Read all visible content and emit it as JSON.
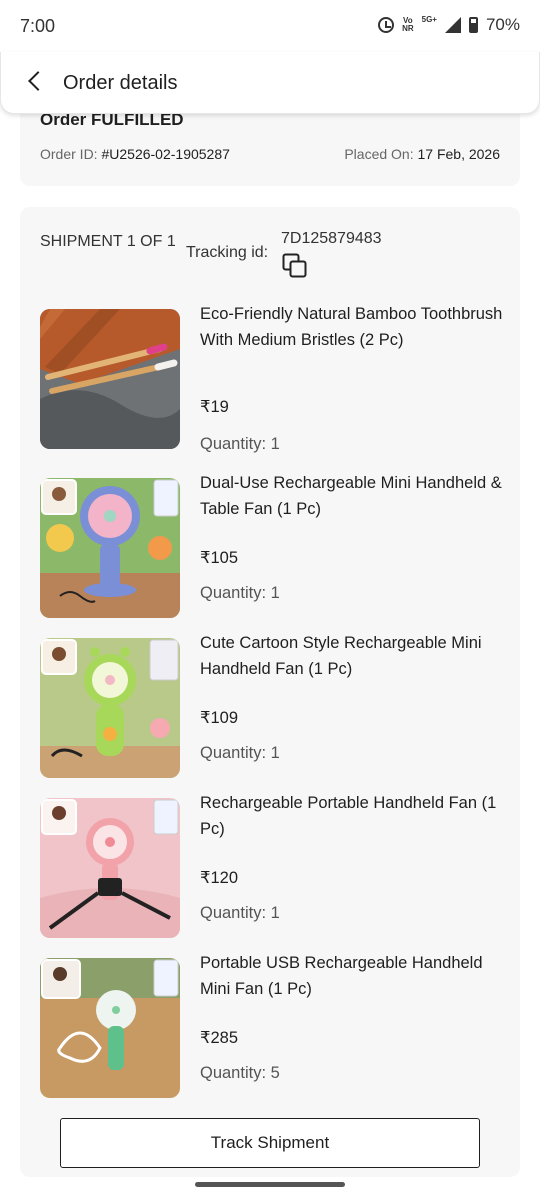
{
  "status_bar": {
    "time": "7:00",
    "volte": "Vo\nNR",
    "network": "5G+",
    "battery": "70%"
  },
  "header": {
    "title": "Order details",
    "back_icon": "chevron-left-icon"
  },
  "order": {
    "status": "Order FULFILLED",
    "id_label": "Order ID: ",
    "id_value": "#U2526-02-1905287",
    "placed_label": "Placed On: ",
    "placed_value": "17 Feb, 2026"
  },
  "shipment": {
    "label": "SHIPMENT 1 OF 1",
    "tracking_label": "Tracking id:",
    "tracking_id": "7D125879483",
    "copy_icon": "copy-icon",
    "items": [
      {
        "name": "Eco-Friendly Natural Bamboo Toothbrush With Medium Bristles (2 Pc)",
        "price": "₹19",
        "quantity": "Quantity: 1"
      },
      {
        "name": "Dual-Use Rechargeable Mini Handheld & Table Fan (1 Pc)",
        "price": "₹105",
        "quantity": "Quantity: 1"
      },
      {
        "name": "Cute Cartoon Style Rechargeable Mini Handheld Fan (1 Pc)",
        "price": "₹109",
        "quantity": "Quantity: 1"
      },
      {
        "name": "Rechargeable Portable Handheld Fan (1 Pc)",
        "price": "₹120",
        "quantity": "Quantity: 1"
      },
      {
        "name": "Portable USB Rechargeable Handheld Mini Fan (1 Pc)",
        "price": "₹285",
        "quantity": "Quantity: 5"
      }
    ],
    "track_button": "Track Shipment"
  }
}
